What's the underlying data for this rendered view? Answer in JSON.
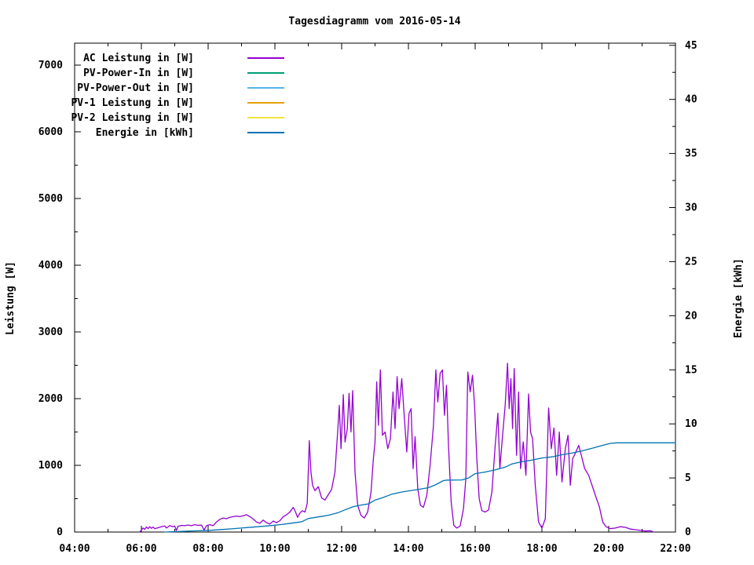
{
  "title": "Tagesdiagramm vom 2016-05-14",
  "chart_data": {
    "type": "line",
    "title": "Tagesdiagramm vom 2016-05-14",
    "grid": false,
    "legend_position": "top-left-inside",
    "x_axis": {
      "range_hours": [
        4,
        22
      ],
      "tick_values": [
        4,
        6,
        8,
        10,
        12,
        14,
        16,
        18,
        20,
        22
      ],
      "tick_labels": [
        "04:00",
        "06:00",
        "08:00",
        "10:00",
        "12:00",
        "14:00",
        "16:00",
        "18:00",
        "20:00",
        "22:00"
      ],
      "minor_step_hours": 1
    },
    "y_left": {
      "label": "Leistung [W]",
      "range": [
        0,
        7329
      ],
      "tick_step": 1000,
      "minor_step": 500,
      "tick_max": 7000
    },
    "y_right": {
      "label": "Energie [kWh]",
      "range": [
        0,
        45.2
      ],
      "tick_step": 5,
      "minor_step": 2.5,
      "tick_max": 45
    },
    "legend": [
      {
        "label": "AC Leistung in [W]",
        "color": "#9400d3"
      },
      {
        "label": "PV-Power-In in [W]",
        "color": "#009e73"
      },
      {
        "label": "PV-Power-Out in [W]",
        "color": "#56b4e9"
      },
      {
        "label": "PV-1 Leistung in [W]",
        "color": "#e69f00"
      },
      {
        "label": "PV-2 Leistung in [W]",
        "color": "#f0e442"
      },
      {
        "label": "Energie in [kWh]",
        "color": "#0072b2"
      }
    ],
    "series": [
      {
        "name": "AC Leistung in [W]",
        "color": "#9400d3",
        "axis": "left",
        "points": [
          [
            5.95,
            0
          ],
          [
            6.0,
            30
          ],
          [
            6.05,
            60
          ],
          [
            6.1,
            40
          ],
          [
            6.15,
            75
          ],
          [
            6.2,
            50
          ],
          [
            6.25,
            80
          ],
          [
            6.3,
            55
          ],
          [
            6.35,
            75
          ],
          [
            6.4,
            50
          ],
          [
            6.5,
            65
          ],
          [
            6.6,
            80
          ],
          [
            6.7,
            90
          ],
          [
            6.75,
            60
          ],
          [
            6.85,
            95
          ],
          [
            6.95,
            80
          ],
          [
            7.0,
            90
          ],
          [
            7.05,
            25
          ],
          [
            7.1,
            85
          ],
          [
            7.2,
            100
          ],
          [
            7.3,
            95
          ],
          [
            7.4,
            105
          ],
          [
            7.5,
            95
          ],
          [
            7.6,
            110
          ],
          [
            7.7,
            100
          ],
          [
            7.8,
            105
          ],
          [
            7.88,
            30
          ],
          [
            7.95,
            95
          ],
          [
            8.05,
            110
          ],
          [
            8.15,
            95
          ],
          [
            8.25,
            150
          ],
          [
            8.35,
            190
          ],
          [
            8.45,
            210
          ],
          [
            8.55,
            200
          ],
          [
            8.65,
            220
          ],
          [
            8.75,
            230
          ],
          [
            8.85,
            240
          ],
          [
            8.95,
            230
          ],
          [
            9.05,
            245
          ],
          [
            9.15,
            260
          ],
          [
            9.25,
            230
          ],
          [
            9.35,
            195
          ],
          [
            9.45,
            150
          ],
          [
            9.55,
            130
          ],
          [
            9.65,
            180
          ],
          [
            9.75,
            140
          ],
          [
            9.85,
            120
          ],
          [
            9.95,
            165
          ],
          [
            10.05,
            140
          ],
          [
            10.15,
            170
          ],
          [
            10.25,
            230
          ],
          [
            10.35,
            260
          ],
          [
            10.45,
            300
          ],
          [
            10.55,
            370
          ],
          [
            10.62,
            300
          ],
          [
            10.68,
            220
          ],
          [
            10.75,
            285
          ],
          [
            10.82,
            320
          ],
          [
            10.9,
            300
          ],
          [
            10.97,
            430
          ],
          [
            11.03,
            1370
          ],
          [
            11.08,
            900
          ],
          [
            11.13,
            700
          ],
          [
            11.2,
            620
          ],
          [
            11.3,
            680
          ],
          [
            11.4,
            510
          ],
          [
            11.5,
            480
          ],
          [
            11.6,
            560
          ],
          [
            11.7,
            640
          ],
          [
            11.8,
            900
          ],
          [
            11.88,
            1500
          ],
          [
            11.93,
            1900
          ],
          [
            11.98,
            1250
          ],
          [
            12.05,
            2060
          ],
          [
            12.1,
            1350
          ],
          [
            12.17,
            1550
          ],
          [
            12.22,
            2080
          ],
          [
            12.28,
            1500
          ],
          [
            12.33,
            2120
          ],
          [
            12.4,
            900
          ],
          [
            12.48,
            400
          ],
          [
            12.58,
            250
          ],
          [
            12.68,
            210
          ],
          [
            12.78,
            300
          ],
          [
            12.88,
            600
          ],
          [
            12.95,
            1100
          ],
          [
            13.0,
            1350
          ],
          [
            13.05,
            2250
          ],
          [
            13.1,
            1600
          ],
          [
            13.16,
            2430
          ],
          [
            13.22,
            1450
          ],
          [
            13.3,
            1500
          ],
          [
            13.38,
            1250
          ],
          [
            13.46,
            1400
          ],
          [
            13.54,
            2100
          ],
          [
            13.6,
            1550
          ],
          [
            13.66,
            2330
          ],
          [
            13.72,
            1850
          ],
          [
            13.8,
            2300
          ],
          [
            13.88,
            1700
          ],
          [
            13.95,
            1200
          ],
          [
            14.02,
            1780
          ],
          [
            14.08,
            1850
          ],
          [
            14.14,
            950
          ],
          [
            14.2,
            1430
          ],
          [
            14.28,
            650
          ],
          [
            14.36,
            400
          ],
          [
            14.45,
            370
          ],
          [
            14.55,
            550
          ],
          [
            14.65,
            1000
          ],
          [
            14.75,
            1600
          ],
          [
            14.82,
            2430
          ],
          [
            14.88,
            1950
          ],
          [
            14.95,
            2380
          ],
          [
            15.02,
            2430
          ],
          [
            15.08,
            1750
          ],
          [
            15.14,
            2200
          ],
          [
            15.2,
            1300
          ],
          [
            15.28,
            450
          ],
          [
            15.36,
            100
          ],
          [
            15.45,
            60
          ],
          [
            15.55,
            90
          ],
          [
            15.65,
            350
          ],
          [
            15.72,
            800
          ],
          [
            15.78,
            2400
          ],
          [
            15.85,
            2100
          ],
          [
            15.92,
            2350
          ],
          [
            15.98,
            1900
          ],
          [
            16.05,
            1100
          ],
          [
            16.12,
            500
          ],
          [
            16.2,
            320
          ],
          [
            16.3,
            300
          ],
          [
            16.4,
            330
          ],
          [
            16.5,
            600
          ],
          [
            16.6,
            1300
          ],
          [
            16.68,
            1780
          ],
          [
            16.74,
            950
          ],
          [
            16.82,
            1450
          ],
          [
            16.9,
            1900
          ],
          [
            16.97,
            2530
          ],
          [
            17.02,
            1850
          ],
          [
            17.07,
            2300
          ],
          [
            17.12,
            1550
          ],
          [
            17.17,
            2450
          ],
          [
            17.24,
            1150
          ],
          [
            17.3,
            2100
          ],
          [
            17.36,
            950
          ],
          [
            17.44,
            1350
          ],
          [
            17.52,
            850
          ],
          [
            17.6,
            2070
          ],
          [
            17.66,
            1500
          ],
          [
            17.72,
            1400
          ],
          [
            17.8,
            700
          ],
          [
            17.9,
            150
          ],
          [
            18.0,
            60
          ],
          [
            18.1,
            200
          ],
          [
            18.2,
            1860
          ],
          [
            18.28,
            1250
          ],
          [
            18.36,
            1560
          ],
          [
            18.44,
            850
          ],
          [
            18.52,
            1500
          ],
          [
            18.6,
            750
          ],
          [
            18.7,
            1250
          ],
          [
            18.78,
            1450
          ],
          [
            18.85,
            700
          ],
          [
            18.92,
            1100
          ],
          [
            19.0,
            1180
          ],
          [
            19.1,
            1300
          ],
          [
            19.18,
            1150
          ],
          [
            19.28,
            950
          ],
          [
            19.4,
            850
          ],
          [
            19.5,
            700
          ],
          [
            19.6,
            550
          ],
          [
            19.72,
            380
          ],
          [
            19.82,
            150
          ],
          [
            19.92,
            80
          ],
          [
            20.05,
            50
          ],
          [
            20.2,
            60
          ],
          [
            20.35,
            80
          ],
          [
            20.5,
            70
          ],
          [
            20.65,
            45
          ],
          [
            20.8,
            35
          ],
          [
            20.95,
            25
          ],
          [
            21.1,
            15
          ],
          [
            21.25,
            20
          ],
          [
            21.35,
            0
          ]
        ]
      },
      {
        "name": "PV-Power-In in [W]",
        "color": "#009e73",
        "axis": "left",
        "points": []
      },
      {
        "name": "PV-Power-Out in [W]",
        "color": "#56b4e9",
        "axis": "left",
        "points": []
      },
      {
        "name": "PV-1 Leistung in [W]",
        "color": "#e69f00",
        "axis": "left",
        "points": []
      },
      {
        "name": "PV-2 Leistung in [W]",
        "color": "#f0e442",
        "axis": "left",
        "points": []
      },
      {
        "name": "Energie in [kWh]",
        "color": "#0072b2",
        "axis": "right",
        "points": [
          [
            6.7,
            0
          ],
          [
            6.9,
            0.03
          ],
          [
            7.2,
            0.06
          ],
          [
            7.5,
            0.1
          ],
          [
            7.8,
            0.13
          ],
          [
            8.1,
            0.17
          ],
          [
            8.4,
            0.23
          ],
          [
            8.7,
            0.3
          ],
          [
            9.0,
            0.37
          ],
          [
            9.3,
            0.45
          ],
          [
            9.6,
            0.52
          ],
          [
            9.9,
            0.6
          ],
          [
            10.2,
            0.7
          ],
          [
            10.5,
            0.82
          ],
          [
            10.8,
            0.95
          ],
          [
            11.0,
            1.25
          ],
          [
            11.3,
            1.4
          ],
          [
            11.6,
            1.55
          ],
          [
            11.9,
            1.8
          ],
          [
            12.1,
            2.05
          ],
          [
            12.35,
            2.35
          ],
          [
            12.6,
            2.5
          ],
          [
            12.8,
            2.6
          ],
          [
            13.0,
            2.95
          ],
          [
            13.2,
            3.15
          ],
          [
            13.5,
            3.5
          ],
          [
            13.8,
            3.7
          ],
          [
            14.0,
            3.8
          ],
          [
            14.3,
            3.95
          ],
          [
            14.6,
            4.1
          ],
          [
            14.8,
            4.35
          ],
          [
            15.05,
            4.75
          ],
          [
            15.15,
            4.8
          ],
          [
            15.6,
            4.82
          ],
          [
            15.8,
            5.0
          ],
          [
            16.0,
            5.4
          ],
          [
            16.3,
            5.55
          ],
          [
            16.6,
            5.75
          ],
          [
            16.9,
            6.0
          ],
          [
            17.1,
            6.3
          ],
          [
            17.4,
            6.5
          ],
          [
            17.7,
            6.65
          ],
          [
            18.0,
            6.85
          ],
          [
            18.3,
            6.95
          ],
          [
            18.6,
            7.15
          ],
          [
            18.9,
            7.3
          ],
          [
            19.2,
            7.5
          ],
          [
            19.5,
            7.75
          ],
          [
            19.8,
            8.0
          ],
          [
            20.05,
            8.2
          ],
          [
            20.25,
            8.25
          ],
          [
            22.0,
            8.25
          ]
        ]
      }
    ]
  }
}
